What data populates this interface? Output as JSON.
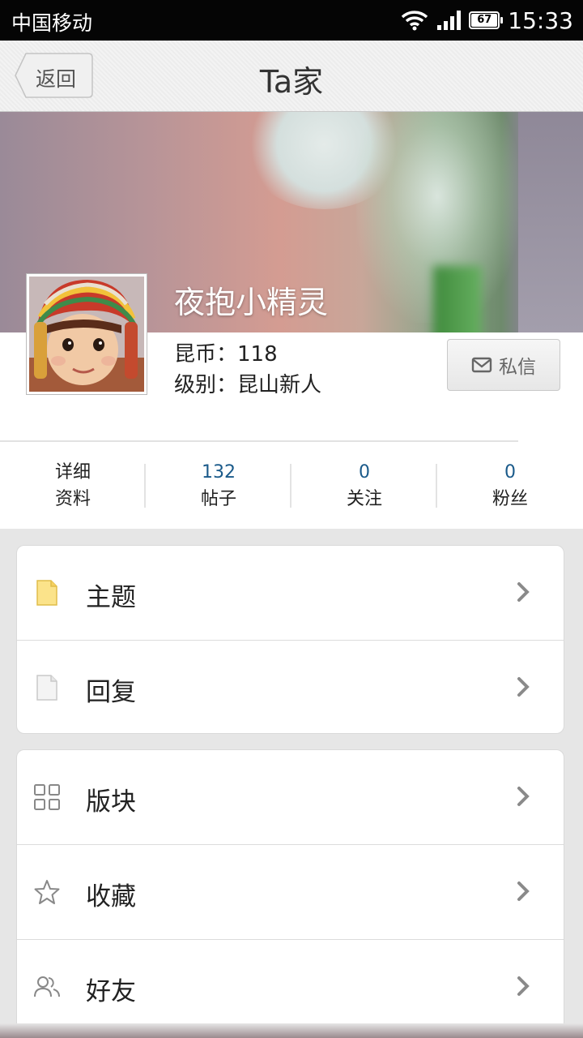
{
  "status_bar": {
    "carrier": "中国移动",
    "battery": "67",
    "time": "15:33"
  },
  "header": {
    "back_label": "返回",
    "title": "Ta家"
  },
  "profile": {
    "username": "夜抱小精灵",
    "coins_line": "昆币：118",
    "level_line": "级别：昆山新人",
    "message_label": "私信"
  },
  "stats": [
    {
      "top": "详细",
      "bottom": "资料"
    },
    {
      "top": "132",
      "bottom": "帖子"
    },
    {
      "top": "0",
      "bottom": "关注"
    },
    {
      "top": "0",
      "bottom": "粉丝"
    }
  ],
  "menu_groups": [
    [
      {
        "label": "主题",
        "icon": "topic-icon"
      },
      {
        "label": "回复",
        "icon": "reply-icon"
      }
    ],
    [
      {
        "label": "版块",
        "icon": "grid-icon"
      },
      {
        "label": "收藏",
        "icon": "star-icon"
      },
      {
        "label": "好友",
        "icon": "friends-icon"
      }
    ]
  ],
  "colors": {
    "stat_number": "#1a5a8a",
    "topbar": "#050505"
  }
}
